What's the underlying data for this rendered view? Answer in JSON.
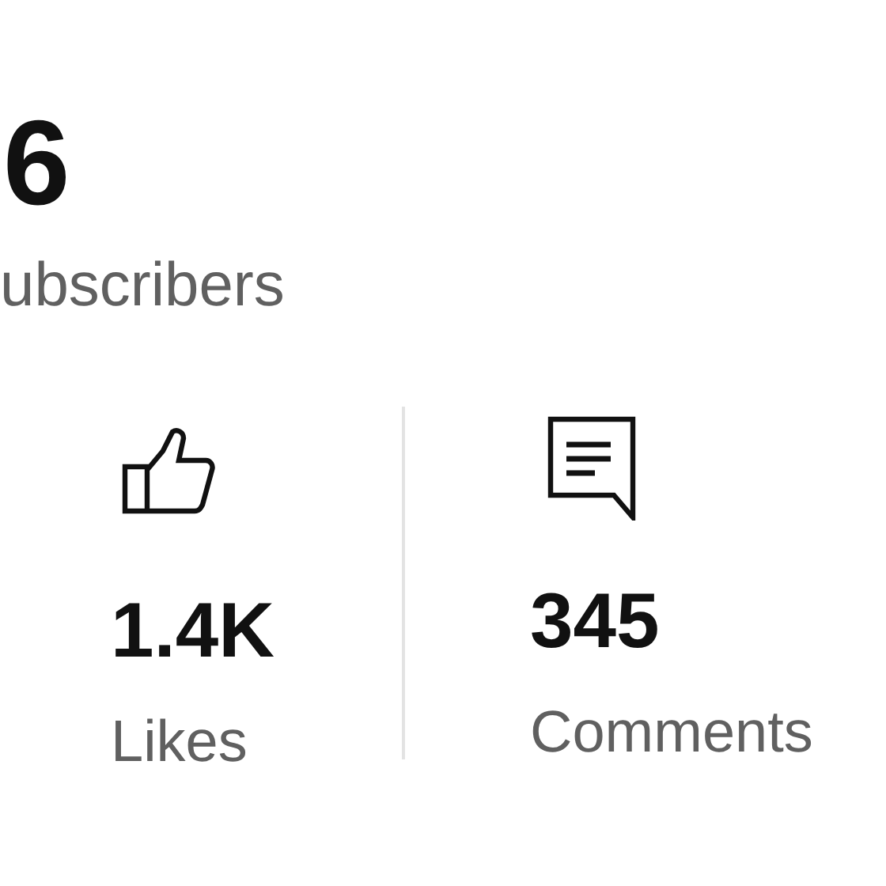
{
  "subscribers": {
    "count": "6",
    "label": "ubscribers"
  },
  "stats": [
    {
      "kind": "likes",
      "value": "1.4K",
      "label": "Likes"
    },
    {
      "kind": "comments",
      "value": "345",
      "label": "Comments"
    }
  ]
}
